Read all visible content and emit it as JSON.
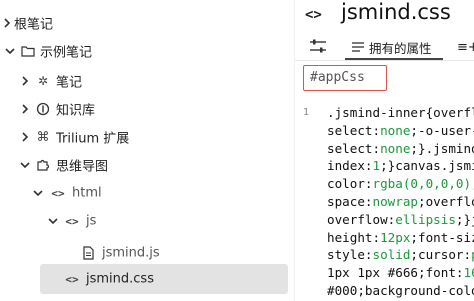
{
  "tree": {
    "items": [
      {
        "label": "根笔记",
        "icon": "chevron-right-icon"
      },
      {
        "label": "示例笔记",
        "icon": "folder-icon"
      },
      {
        "label": "笔记",
        "icon": "asterisk-icon"
      },
      {
        "label": "知识库",
        "icon": "circle-info-icon"
      },
      {
        "label": "Trilium 扩展",
        "icon": "command-icon"
      },
      {
        "label": "思维导图",
        "icon": "puzzle-icon"
      },
      {
        "label": "html",
        "icon": "code-icon"
      },
      {
        "label": "js",
        "icon": "code-icon"
      },
      {
        "label": "jsmind.js",
        "icon": "file-icon"
      },
      {
        "label": "jsmind.css",
        "icon": "code-icon"
      }
    ]
  },
  "editor": {
    "title": "jsmind.css",
    "title_icon": "<>",
    "tabs": {
      "owned_label": "拥有的属性",
      "more_label": "≡+"
    },
    "search_value": "#appCss",
    "line_number": "1",
    "code_lines": [
      [
        ".jsmind-inner{overfl",
        "p"
      ],
      [
        "select:none;-o-user-",
        "p"
      ],
      [
        "select:none;}.jsmind",
        "p"
      ],
      [
        "index:1;}canvas.jsmi",
        "mix"
      ],
      [
        "color:rgba(0,0,0,0);",
        "mix"
      ],
      [
        "space:nowrap;overflo",
        "mix"
      ],
      [
        "overflow:ellipsis;}j",
        "mix"
      ],
      [
        "height:12px;font-siz",
        "mix"
      ],
      [
        "style:solid;cursor:p",
        "mix"
      ],
      [
        "1px 1px #666;font:16",
        "p"
      ],
      [
        "#000;background-colo",
        "p"
      ]
    ]
  }
}
